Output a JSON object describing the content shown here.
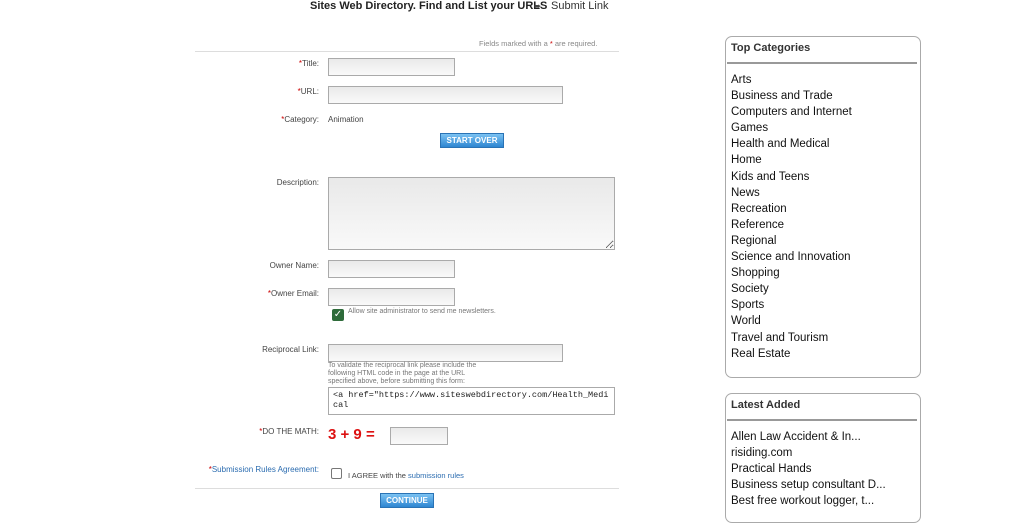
{
  "header": {
    "title": "Sites Web Directory. Find and List your URLS",
    "submit_link": "Submit Link"
  },
  "form": {
    "required_note": "Fields marked with a",
    "required_note_star": "*",
    "required_note_end": "are required.",
    "title_label": "Title:",
    "url_label": "URL:",
    "category_label": "Category:",
    "category_value": "Animation",
    "start_over": "START OVER",
    "description_label": "Description:",
    "owner_name_label": "Owner Name:",
    "owner_email_label": "Owner Email:",
    "newsletter_label": "Allow site administrator to send me newsletters.",
    "reciprocal_label": "Reciprocal Link:",
    "reciprocal_help": [
      "To validate the reciprocal link please include the",
      "following HTML code in the page at the URL",
      "specified above, before submitting this form:"
    ],
    "reciprocal_code": "<a href=\"https://www.siteswebdirectory.com/Health_Medical",
    "math_label": "DO THE MATH:",
    "math_expr": "3 + 9 =",
    "rules_label": "Submission Rules Agreement:",
    "agree_text": "I AGREE with the",
    "agree_link": "submission rules",
    "continue": "CONTINUE"
  },
  "top_categories": {
    "title": "Top Categories",
    "items": [
      "Arts",
      "Business and Trade",
      "Computers and Internet",
      "Games",
      "Health and Medical",
      "Home",
      "Kids and Teens",
      "News",
      "Recreation",
      "Reference",
      "Regional",
      "Science and Innovation",
      "Shopping",
      "Society",
      "Sports",
      "World",
      "Travel and Tourism",
      "Real Estate"
    ]
  },
  "latest_added": {
    "title": "Latest Added",
    "items": [
      "Allen Law Accident & In...",
      "risiding.com",
      "Practical Hands",
      "Business setup consultant D...",
      "Best free workout logger, t..."
    ]
  },
  "colors": {
    "required": "#cc0000",
    "button": "#2e86d1",
    "link": "#2b6cb0",
    "math": "#dd1111"
  }
}
